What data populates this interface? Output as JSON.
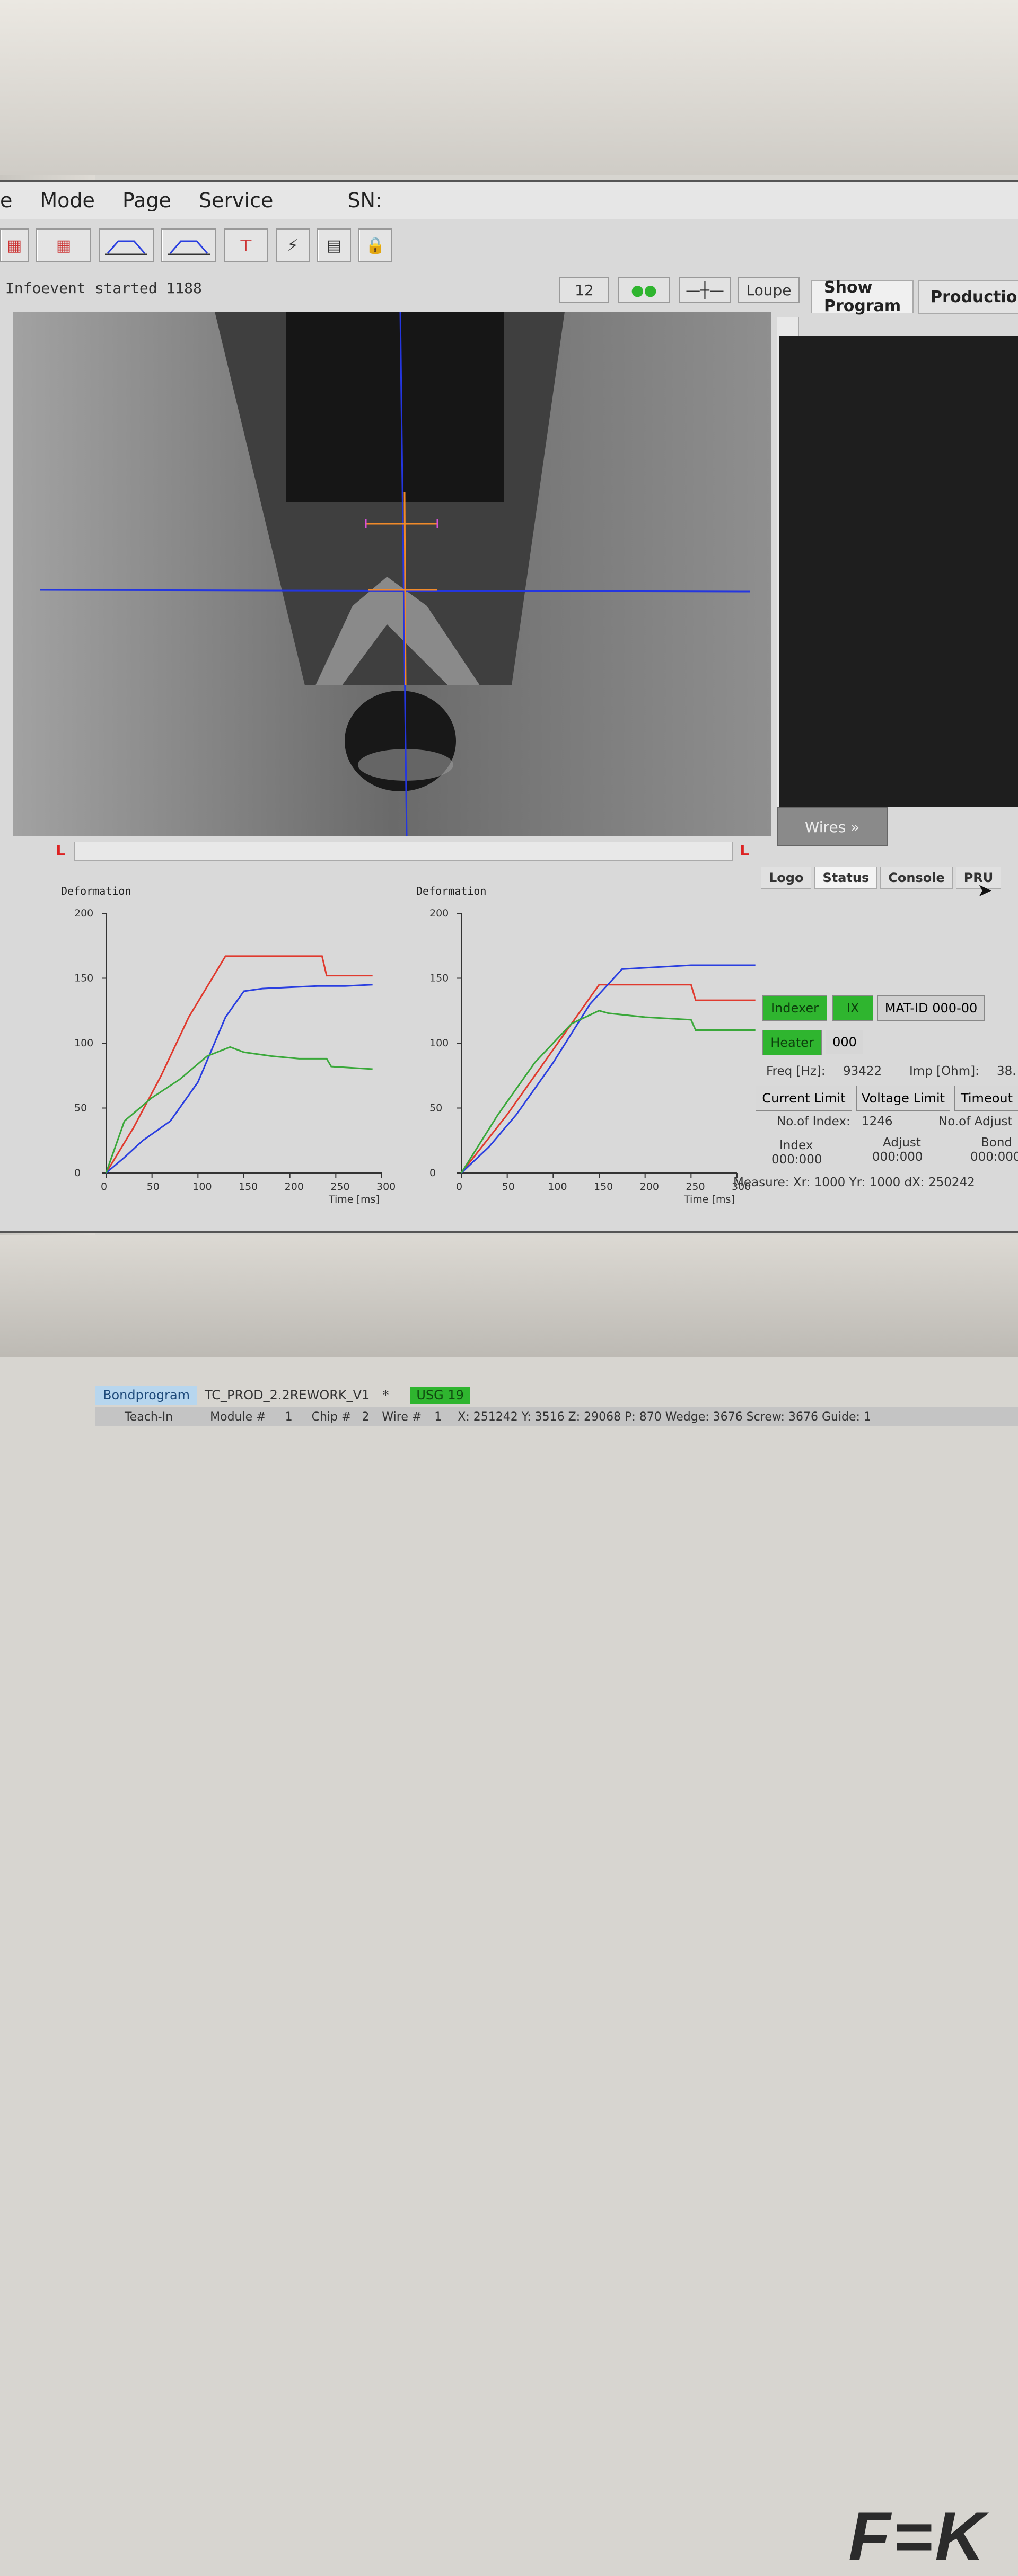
{
  "menu": {
    "items": [
      "e",
      "Mode",
      "Page",
      "Service"
    ],
    "sn_label": "SN:"
  },
  "info": {
    "text": "Infoevent started 1188",
    "counter": "12",
    "loupe_label": "Loupe"
  },
  "right_tabs": [
    "Show Program",
    "Production"
  ],
  "wires_button": "Wires »",
  "status_tabs": [
    "Logo",
    "Status",
    "Console",
    "PRU"
  ],
  "status": {
    "indexer": "Indexer",
    "ix": "IX",
    "mat_id": "MAT-ID 000-00",
    "heater": "Heater",
    "heater_value": "000",
    "freq_label": "Freq [Hz]:",
    "freq_value": "93422",
    "imp_label": "Imp [Ohm]:",
    "imp_value": "38.",
    "current_limit": "Current Limit",
    "voltage_limit": "Voltage Limit",
    "timeout": "Timeout",
    "no_of_index_label": "No.of Index:",
    "no_of_index_value": "1246",
    "no_of_adjust": "No.of Adjust",
    "index_label": "Index",
    "index_value": "000:000",
    "adjust_label": "Adjust",
    "adjust_value": "000:000",
    "bond_label": "Bond",
    "bond_value": "000:000",
    "measure": "Measure: Xr: 1000 Yr: 1000 dX: 250242"
  },
  "bottom": {
    "bondprogram_label": "Bondprogram",
    "program_name": "TC_PROD_2.2REWORK_V1",
    "modified_mark": "*",
    "usg": "USG 19",
    "teach_in": "Teach-In",
    "module": "Module #",
    "module_value": "1",
    "chip": "Chip #",
    "chip_value": "2",
    "wire": "Wire #",
    "wire_value": "1",
    "coords": "X: 251242 Y: 3516 Z: 29068 P: 870 Wedge: 3676 Screw: 3676 Guide: 1"
  },
  "brand": "F=K",
  "chart_data": [
    {
      "type": "line",
      "title": "Deformation",
      "xlabel": "Time [ms]",
      "xlim": [
        0,
        300
      ],
      "ylim": [
        0,
        200
      ],
      "xticks": [
        0,
        50,
        100,
        150,
        200,
        250,
        300
      ],
      "yticks": [
        0,
        50,
        100,
        150,
        200
      ],
      "series": [
        {
          "color": "#e03a2e",
          "x": [
            0,
            30,
            60,
            90,
            130,
            160,
            200,
            235,
            240,
            290
          ],
          "y": [
            0,
            35,
            75,
            120,
            167,
            167,
            167,
            167,
            152,
            152
          ]
        },
        {
          "color": "#2a3fe0",
          "x": [
            0,
            20,
            40,
            70,
            100,
            130,
            150,
            170,
            200,
            230,
            260,
            290
          ],
          "y": [
            0,
            12,
            25,
            40,
            70,
            120,
            140,
            142,
            143,
            144,
            144,
            145
          ]
        },
        {
          "color": "#3aa83a",
          "x": [
            0,
            20,
            50,
            80,
            110,
            135,
            150,
            180,
            210,
            240,
            245,
            290
          ],
          "y": [
            0,
            40,
            58,
            72,
            90,
            97,
            93,
            90,
            88,
            88,
            82,
            80
          ]
        }
      ]
    },
    {
      "type": "line",
      "title": "Deformation",
      "xlabel": "Time [ms]",
      "xlim": [
        0,
        300
      ],
      "ylim": [
        0,
        200
      ],
      "xticks": [
        0,
        50,
        100,
        150,
        200,
        250,
        300
      ],
      "yticks": [
        0,
        50,
        100,
        150,
        200
      ],
      "series": [
        {
          "color": "#e03a2e",
          "x": [
            0,
            50,
            100,
            150,
            200,
            250,
            255,
            320
          ],
          "y": [
            0,
            45,
            95,
            145,
            145,
            145,
            133,
            133
          ]
        },
        {
          "color": "#2a3fe0",
          "x": [
            0,
            30,
            60,
            100,
            140,
            175,
            200,
            250,
            320
          ],
          "y": [
            0,
            20,
            45,
            85,
            130,
            157,
            158,
            160,
            160
          ]
        },
        {
          "color": "#3aa83a",
          "x": [
            0,
            40,
            80,
            120,
            150,
            160,
            200,
            250,
            255,
            320
          ],
          "y": [
            0,
            45,
            85,
            115,
            125,
            123,
            120,
            118,
            110,
            110
          ]
        }
      ]
    }
  ]
}
